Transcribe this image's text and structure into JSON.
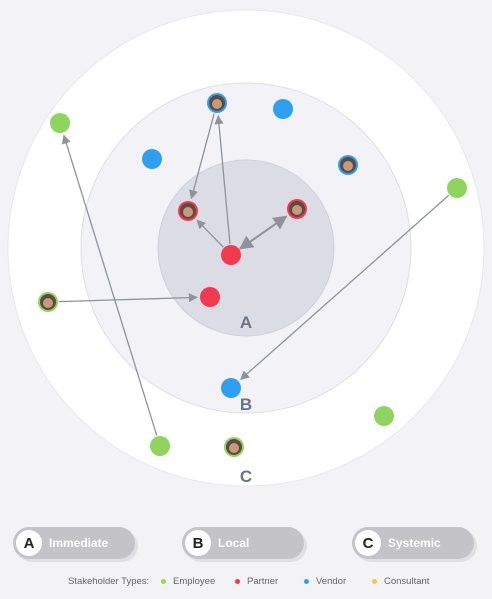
{
  "rings": [
    {
      "letter": "A",
      "name": "Immediate"
    },
    {
      "letter": "B",
      "name": "Local"
    },
    {
      "letter": "C",
      "name": "Systemic"
    }
  ],
  "legend": {
    "title": "Stakeholder Types:",
    "items": [
      {
        "name": "Employee",
        "color": "#9bd64e"
      },
      {
        "name": "Partner",
        "color": "#f2394f"
      },
      {
        "name": "Vendor",
        "color": "#2f9ff0"
      },
      {
        "name": "Consultant",
        "color": "#f7c34a"
      }
    ]
  },
  "colors": {
    "employee": "#8fd45e",
    "partner": "#f2394f",
    "vendor": "#2f9ff0",
    "arrow": "#8e939b"
  },
  "stakeholders": [
    {
      "id": "partner-center",
      "type": "partner",
      "kind": "dot",
      "ring": "A"
    },
    {
      "id": "partner-mid",
      "type": "partner",
      "kind": "dot",
      "ring": "A"
    },
    {
      "id": "partner-avatar-left",
      "type": "partner",
      "kind": "avatar",
      "ring": "A"
    },
    {
      "id": "partner-avatar-right",
      "type": "partner",
      "kind": "avatar",
      "ring": "A"
    },
    {
      "id": "vendor-avatar-top",
      "type": "vendor",
      "kind": "avatar",
      "ring": "B"
    },
    {
      "id": "vendor-dot-top",
      "type": "vendor",
      "kind": "dot",
      "ring": "B"
    },
    {
      "id": "vendor-dot-left",
      "type": "vendor",
      "kind": "dot",
      "ring": "B"
    },
    {
      "id": "vendor-avatar-right",
      "type": "vendor",
      "kind": "avatar",
      "ring": "B"
    },
    {
      "id": "vendor-dot-bottom",
      "type": "vendor",
      "kind": "dot",
      "ring": "B"
    },
    {
      "id": "employee-dot-topleft",
      "type": "employee",
      "kind": "dot",
      "ring": "C"
    },
    {
      "id": "employee-dot-right",
      "type": "employee",
      "kind": "dot",
      "ring": "C"
    },
    {
      "id": "employee-avatar-left",
      "type": "employee",
      "kind": "avatar",
      "ring": "C"
    },
    {
      "id": "employee-dot-bottomright",
      "type": "employee",
      "kind": "dot",
      "ring": "C"
    },
    {
      "id": "employee-dot-bottomleft",
      "type": "employee",
      "kind": "dot",
      "ring": "C"
    },
    {
      "id": "employee-avatar-bottom",
      "type": "employee",
      "kind": "avatar",
      "ring": "C"
    }
  ],
  "links": [
    {
      "from": "vendor-avatar-top",
      "to": "partner-avatar-left"
    },
    {
      "from": "partner-center",
      "to": "vendor-avatar-top"
    },
    {
      "from": "partner-center",
      "to": "partner-avatar-left"
    },
    {
      "from": "partner-center",
      "to": "partner-avatar-right",
      "bidirectional": true
    },
    {
      "from": "employee-avatar-left",
      "to": "partner-mid"
    },
    {
      "from": "employee-dot-bottomleft",
      "to": "employee-dot-topleft"
    },
    {
      "from": "employee-dot-right",
      "to": "vendor-dot-bottom"
    }
  ]
}
